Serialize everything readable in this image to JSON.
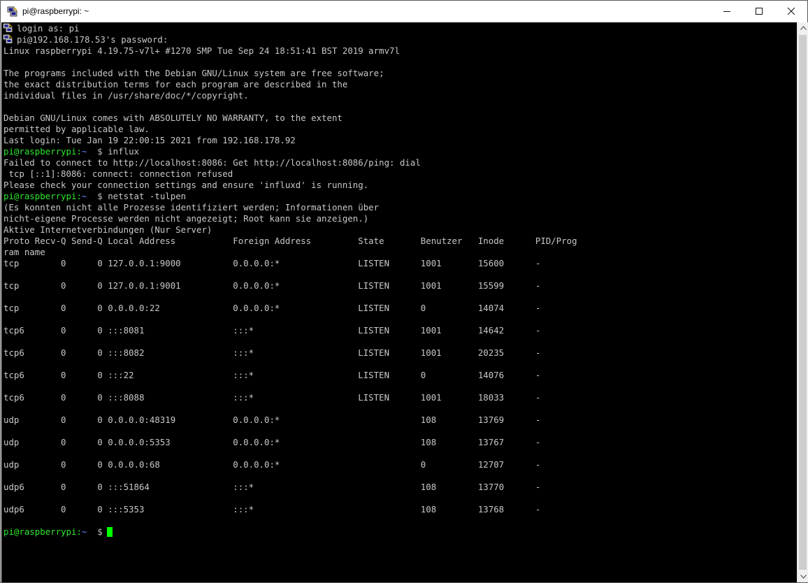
{
  "window": {
    "title": "pi@raspberrypi: ~",
    "controls": {
      "minimize": "—",
      "maximize": "☐",
      "close": "✕"
    },
    "icon": "putty-icon"
  },
  "terminal": {
    "colors": {
      "background": "#000000",
      "text": "#c8c8c8",
      "prompt_user": "#2ee82e",
      "prompt_path": "#5b8cff",
      "cursor": "#00ff00"
    },
    "prompt": {
      "user": "pi@raspberrypi",
      "sep": ":",
      "path": "~",
      "symbol": " $ "
    },
    "lines": [
      {
        "kind": "icon",
        "text": "login as: pi"
      },
      {
        "kind": "icon",
        "text": "pi@192.168.178.53's password:"
      },
      {
        "kind": "out",
        "text": "Linux raspberrypi 4.19.75-v7l+ #1270 SMP Tue Sep 24 18:51:41 BST 2019 armv7l"
      },
      {
        "kind": "out",
        "text": ""
      },
      {
        "kind": "out",
        "text": "The programs included with the Debian GNU/Linux system are free software;"
      },
      {
        "kind": "out",
        "text": "the exact distribution terms for each program are described in the"
      },
      {
        "kind": "out",
        "text": "individual files in /usr/share/doc/*/copyright."
      },
      {
        "kind": "out",
        "text": ""
      },
      {
        "kind": "out",
        "text": "Debian GNU/Linux comes with ABSOLUTELY NO WARRANTY, to the extent"
      },
      {
        "kind": "out",
        "text": "permitted by applicable law."
      },
      {
        "kind": "out",
        "text": "Last login: Tue Jan 19 22:00:15 2021 from 192.168.178.92"
      },
      {
        "kind": "cmd",
        "text": "influx"
      },
      {
        "kind": "out",
        "text": "Failed to connect to http://localhost:8086: Get http://localhost:8086/ping: dial"
      },
      {
        "kind": "out",
        "text": " tcp [::1]:8086: connect: connection refused"
      },
      {
        "kind": "out",
        "text": "Please check your connection settings and ensure 'influxd' is running."
      },
      {
        "kind": "cmd",
        "text": "netstat -tulpen"
      },
      {
        "kind": "out",
        "text": "(Es konnten nicht alle Prozesse identifiziert werden; Informationen über"
      },
      {
        "kind": "out",
        "text": "nicht-eigene Processe werden nicht angezeigt; Root kann sie anzeigen.)"
      },
      {
        "kind": "out",
        "text": "Aktive Internetverbindungen (Nur Server)"
      },
      {
        "kind": "out",
        "text": "Proto Recv-Q Send-Q Local Address           Foreign Address         State       Benutzer   Inode      PID/Prog"
      },
      {
        "kind": "out",
        "text": "ram name"
      },
      {
        "kind": "out",
        "text": "tcp        0      0 127.0.0.1:9000          0.0.0.0:*               LISTEN      1001       15600      -"
      },
      {
        "kind": "out",
        "text": ""
      },
      {
        "kind": "out",
        "text": "tcp        0      0 127.0.0.1:9001          0.0.0.0:*               LISTEN      1001       15599      -"
      },
      {
        "kind": "out",
        "text": ""
      },
      {
        "kind": "out",
        "text": "tcp        0      0 0.0.0.0:22              0.0.0.0:*               LISTEN      0          14074      -"
      },
      {
        "kind": "out",
        "text": ""
      },
      {
        "kind": "out",
        "text": "tcp6       0      0 :::8081                 :::*                    LISTEN      1001       14642      -"
      },
      {
        "kind": "out",
        "text": ""
      },
      {
        "kind": "out",
        "text": "tcp6       0      0 :::8082                 :::*                    LISTEN      1001       20235      -"
      },
      {
        "kind": "out",
        "text": ""
      },
      {
        "kind": "out",
        "text": "tcp6       0      0 :::22                   :::*                    LISTEN      0          14076      -"
      },
      {
        "kind": "out",
        "text": ""
      },
      {
        "kind": "out",
        "text": "tcp6       0      0 :::8088                 :::*                    LISTEN      1001       18033      -"
      },
      {
        "kind": "out",
        "text": ""
      },
      {
        "kind": "out",
        "text": "udp        0      0 0.0.0.0:48319           0.0.0.0:*                           108        13769      -"
      },
      {
        "kind": "out",
        "text": ""
      },
      {
        "kind": "out",
        "text": "udp        0      0 0.0.0.0:5353            0.0.0.0:*                           108        13767      -"
      },
      {
        "kind": "out",
        "text": ""
      },
      {
        "kind": "out",
        "text": "udp        0      0 0.0.0.0:68              0.0.0.0:*                           0          12707      -"
      },
      {
        "kind": "out",
        "text": ""
      },
      {
        "kind": "out",
        "text": "udp6       0      0 :::51864                :::*                                108        13770      -"
      },
      {
        "kind": "out",
        "text": ""
      },
      {
        "kind": "out",
        "text": "udp6       0      0 :::5353                 :::*                                108        13768      -"
      },
      {
        "kind": "out",
        "text": ""
      },
      {
        "kind": "cmd",
        "text": "",
        "cursor": true
      }
    ]
  }
}
